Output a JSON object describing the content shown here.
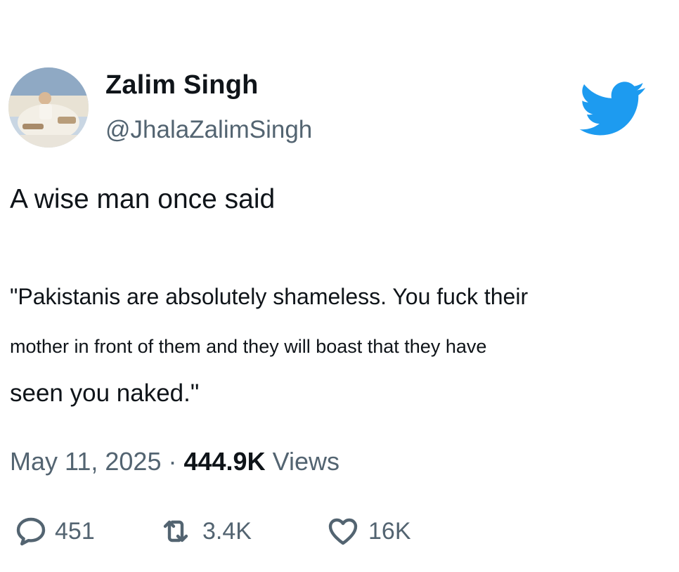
{
  "author": {
    "display_name": "Zalim Singh",
    "handle": "@JhalaZalimSingh"
  },
  "brand": {
    "icon": "twitter-bird-icon",
    "color": "#1d9bf0"
  },
  "tweet": {
    "intro": "A wise man once said",
    "quote_lines": [
      "\"Pakistanis are absolutely shameless. You fuck their",
      "mother in front of them and they will boast that they have",
      "seen you naked.\""
    ],
    "date": "May 11, 2025",
    "separator": " · ",
    "views_count": "444.9K",
    "views_label": " Views"
  },
  "actions": {
    "reply": {
      "icon": "reply-bubble-icon",
      "count": "451"
    },
    "retweet": {
      "icon": "retweet-icon",
      "count": "3.4K"
    },
    "like": {
      "icon": "heart-icon",
      "count": "16K"
    }
  }
}
